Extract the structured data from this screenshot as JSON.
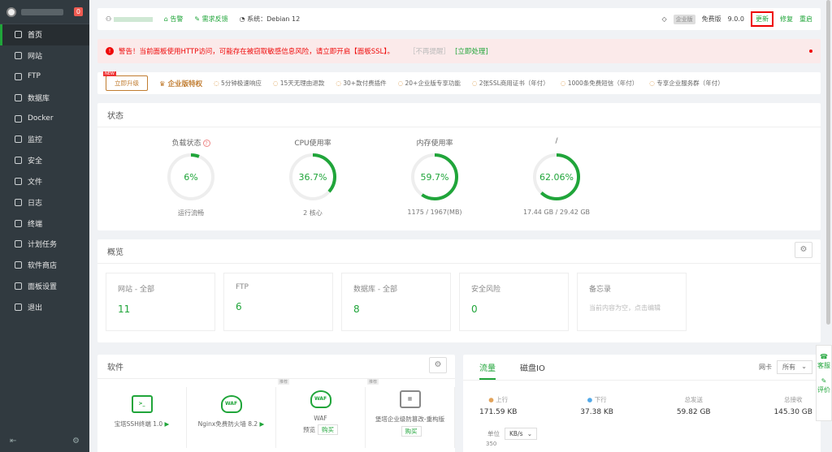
{
  "sidebar": {
    "badge": "0",
    "items": [
      {
        "label": "首页",
        "icon": "home-icon"
      },
      {
        "label": "网站",
        "icon": "globe-icon"
      },
      {
        "label": "FTP",
        "icon": "ftp-icon"
      },
      {
        "label": "数据库",
        "icon": "database-icon"
      },
      {
        "label": "Docker",
        "icon": "docker-icon"
      },
      {
        "label": "监控",
        "icon": "monitor-icon"
      },
      {
        "label": "安全",
        "icon": "shield-icon"
      },
      {
        "label": "文件",
        "icon": "folder-icon"
      },
      {
        "label": "日志",
        "icon": "log-icon"
      },
      {
        "label": "终端",
        "icon": "terminal-icon"
      },
      {
        "label": "计划任务",
        "icon": "clock-icon"
      },
      {
        "label": "软件商店",
        "icon": "store-icon"
      },
      {
        "label": "面板设置",
        "icon": "settings-icon"
      },
      {
        "label": "退出",
        "icon": "logout-icon"
      }
    ]
  },
  "topbar": {
    "alert": "告警",
    "feedback": "需求反馈",
    "system": "系统：Debian 12",
    "ver_tag": "企业版",
    "free": "免费版",
    "version": "9.0.0",
    "update": "更新",
    "repair": "修复",
    "restart": "重启"
  },
  "warning": {
    "icon": "!",
    "text": "警告！当前面板使用HTTP访问，可能存在被窃取敏感信息风险，请立即开启【面板SSL】。",
    "ignore": "［不再提醒］",
    "fix": "[立即处理]"
  },
  "promo": {
    "upgrade": "立即升级",
    "enterprise": "企业版特权",
    "features": [
      "5分钟极速响应",
      "15天无理由退款",
      "30+款付费插件",
      "20+企业版专享功能",
      "2张SSL商用证书（年付）",
      "1000条免费短信（年付）",
      "专享企业服务群（年付）"
    ]
  },
  "status": {
    "title": "状态",
    "gauges": [
      {
        "label": "负载状态",
        "value": "6%",
        "sub": "运行流畅",
        "pct": 6
      },
      {
        "label": "CPU使用率",
        "value": "36.7%",
        "sub": "2 核心",
        "pct": 36.7
      },
      {
        "label": "内存使用率",
        "value": "59.7%",
        "sub": "1175 / 1967(MB)",
        "pct": 59.7
      },
      {
        "label": "/",
        "value": "62.06%",
        "sub": "17.44 GB / 29.42 GB",
        "pct": 62.06
      }
    ]
  },
  "overview": {
    "title": "概览",
    "items": [
      {
        "label": "网站 - 全部",
        "value": "11"
      },
      {
        "label": "FTP",
        "value": "6"
      },
      {
        "label": "数据库 - 全部",
        "value": "8"
      },
      {
        "label": "安全风险",
        "value": "0"
      }
    ],
    "memo_title": "备忘录",
    "memo_text": "当前内容为空，点击编辑"
  },
  "software": {
    "title": "软件",
    "tag": "推荐",
    "items": [
      {
        "name": "宝塔SSH终端 1.0",
        "icon": ">_"
      },
      {
        "name": "Nginx免费防火墙 8.2",
        "icon": "WAF"
      },
      {
        "name": "WAF",
        "icon": "WAF",
        "preview": "预览",
        "buy": "购买"
      },
      {
        "name": "堡塔企业级防篡改-重构版",
        "icon": "▦",
        "buy": "购买"
      }
    ]
  },
  "traffic": {
    "tab_flow": "流量",
    "tab_disk": "磁盘IO",
    "nic_label": "网卡",
    "nic_value": "所有",
    "up_label": "上行",
    "up": "171.59 KB",
    "down_label": "下行",
    "down": "37.38 KB",
    "sent_label": "总发送",
    "sent": "59.82 GB",
    "recv_label": "总接收",
    "recv": "145.30 GB",
    "unit_label": "单位",
    "unit": "KB/s",
    "ytick": "350"
  },
  "float": {
    "service": "客服",
    "rate": "评价"
  },
  "colors": {
    "accent": "#20a53a",
    "danger": "#ef0808",
    "sidebar": "#313a40"
  }
}
